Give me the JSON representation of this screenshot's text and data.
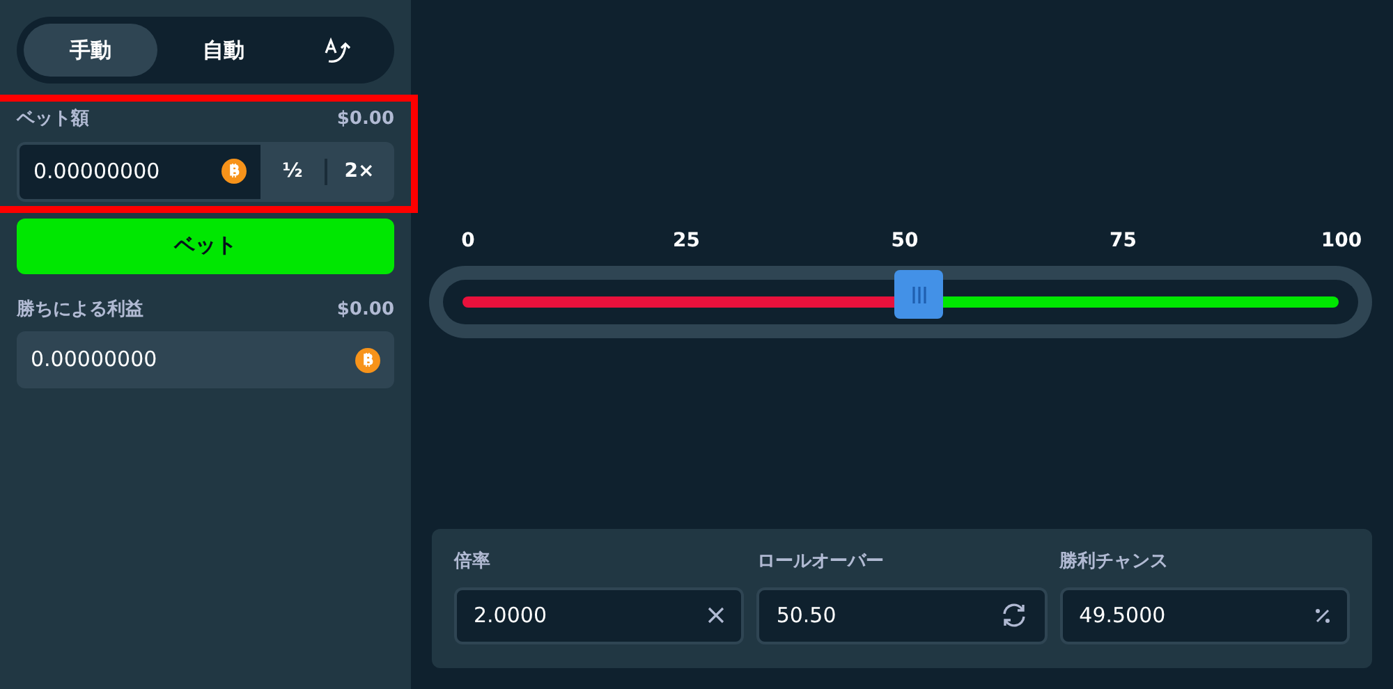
{
  "mode_tabs": [
    {
      "label": "手動",
      "selected": true
    },
    {
      "label": "自動",
      "selected": false
    },
    {
      "kind": "icon",
      "selected": false
    }
  ],
  "bet_amount": {
    "label": "ベット額",
    "usd": "$0.00",
    "value": "0.00000000",
    "half": "½",
    "double": "2×",
    "highlighted": true
  },
  "bet_button": "ベット",
  "profit": {
    "label": "勝ちによる利益",
    "usd": "$0.00",
    "value": "0.00000000"
  },
  "slider": {
    "ticks": [
      "0",
      "25",
      "50",
      "75",
      "100"
    ],
    "level": 0.52
  },
  "stats": [
    {
      "label": "倍率",
      "value": "2.0000",
      "kind": "multiplier"
    },
    {
      "label": "ロールオーバー",
      "value": "50.50",
      "kind": "rollover"
    },
    {
      "label": "勝利チャンス",
      "value": "49.5000",
      "kind": "percent"
    }
  ]
}
